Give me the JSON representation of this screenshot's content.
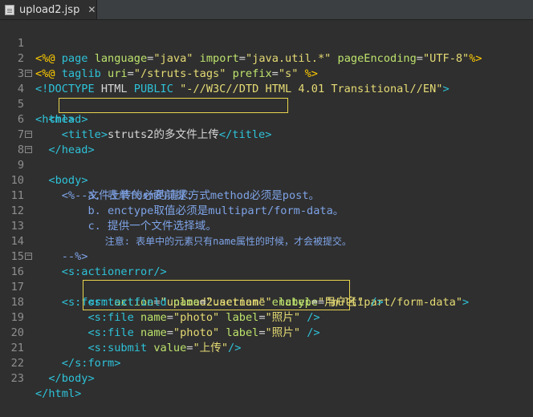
{
  "tab": {
    "filename": "upload2.jsp",
    "close": "✕",
    "icon": "jsp-file-icon"
  },
  "colors": {
    "tag": "#2ec2d8",
    "directive": "#ffcc00",
    "attr": "#bde36c",
    "string": "#e6db74",
    "comment": "#7ea3e6",
    "highlight_box": "#e8d44d"
  },
  "lines": [
    {
      "n": "1",
      "parts": [
        "<%@",
        " ",
        "page",
        " ",
        "language",
        "=",
        "\"java\"",
        " ",
        "import",
        "=",
        "\"java.util.*\"",
        " ",
        "pageEncoding",
        "=",
        "\"UTF-8\"",
        "%>"
      ]
    },
    {
      "n": "2",
      "parts": [
        "<%@",
        " ",
        "taglib",
        " ",
        "uri",
        "=",
        "\"/struts-tags\"",
        " ",
        "prefix",
        "=",
        "\"s\"",
        " ",
        "%>"
      ]
    },
    {
      "n": "3",
      "parts": [
        "<!DOCTYPE",
        " HTML ",
        "PUBLIC",
        " ",
        "\"-//W3C//DTD HTML 4.01 Transitional//EN\"",
        ">"
      ]
    },
    {
      "n": "4",
      "parts": [
        "<",
        "html",
        ">"
      ]
    },
    {
      "n": "5",
      "parts": [
        "  ",
        "<",
        "head",
        ">"
      ]
    },
    {
      "n": "6",
      "parts": [
        "    ",
        "<",
        "title",
        ">",
        "struts2的多文件上传",
        "</",
        "title",
        ">"
      ]
    },
    {
      "n": "7",
      "parts": [
        "  ",
        "</",
        "head",
        ">"
      ]
    },
    {
      "n": "8",
      "parts": [
        "  ",
        "<",
        "body",
        ">"
      ]
    },
    {
      "n": "9",
      "parts": [
        "    ",
        "<%--文件上传的必要前提:"
      ]
    },
    {
      "n": "10",
      "parts": [
        "        a. 表单form的请求方式method必须是post。"
      ]
    },
    {
      "n": "11",
      "parts": [
        "        b. enctype取值必须是multipart/form-data。"
      ]
    },
    {
      "n": "12",
      "parts": [
        "        c. 提供一个文件选择域。"
      ]
    },
    {
      "n": "13",
      "parts": [
        "            注意: 表单中的元素只有name属性的时候，才会被提交。"
      ]
    },
    {
      "n": "14",
      "parts": [
        "    --%>"
      ]
    },
    {
      "n": "15",
      "parts": [
        "    ",
        "<",
        "s:actionerror",
        "/>"
      ]
    },
    {
      "n": "16",
      "parts": [
        "    ",
        "<",
        "s:form",
        " ",
        "action",
        "=",
        "\"upload2.action\"",
        " ",
        "enctype",
        "=",
        "\"multipart/form-data\"",
        ">"
      ]
    },
    {
      "n": "17",
      "parts": [
        "        ",
        "<",
        "s:textfield",
        " ",
        "name",
        "=",
        "\"username\"",
        " ",
        "label",
        "=",
        "\"用户名\"",
        " ",
        "/>"
      ]
    },
    {
      "n": "18",
      "parts": [
        "        ",
        "<",
        "s:file",
        " ",
        "name",
        "=",
        "\"photo\"",
        " ",
        "label",
        "=",
        "\"照片\"",
        " ",
        "/>"
      ]
    },
    {
      "n": "19",
      "parts": [
        "        ",
        "<",
        "s:file",
        " ",
        "name",
        "=",
        "\"photo\"",
        " ",
        "label",
        "=",
        "\"照片\"",
        " ",
        "/>"
      ]
    },
    {
      "n": "20",
      "parts": [
        "        ",
        "<",
        "s:submit",
        " ",
        "value",
        "=",
        "\"上传\"",
        "/>"
      ]
    },
    {
      "n": "21",
      "parts": [
        "    ",
        "</",
        "s:form",
        ">"
      ]
    },
    {
      "n": "22",
      "parts": [
        "  ",
        "</",
        "body",
        ">"
      ]
    },
    {
      "n": "23",
      "parts": [
        "</",
        "html",
        ">"
      ]
    }
  ]
}
